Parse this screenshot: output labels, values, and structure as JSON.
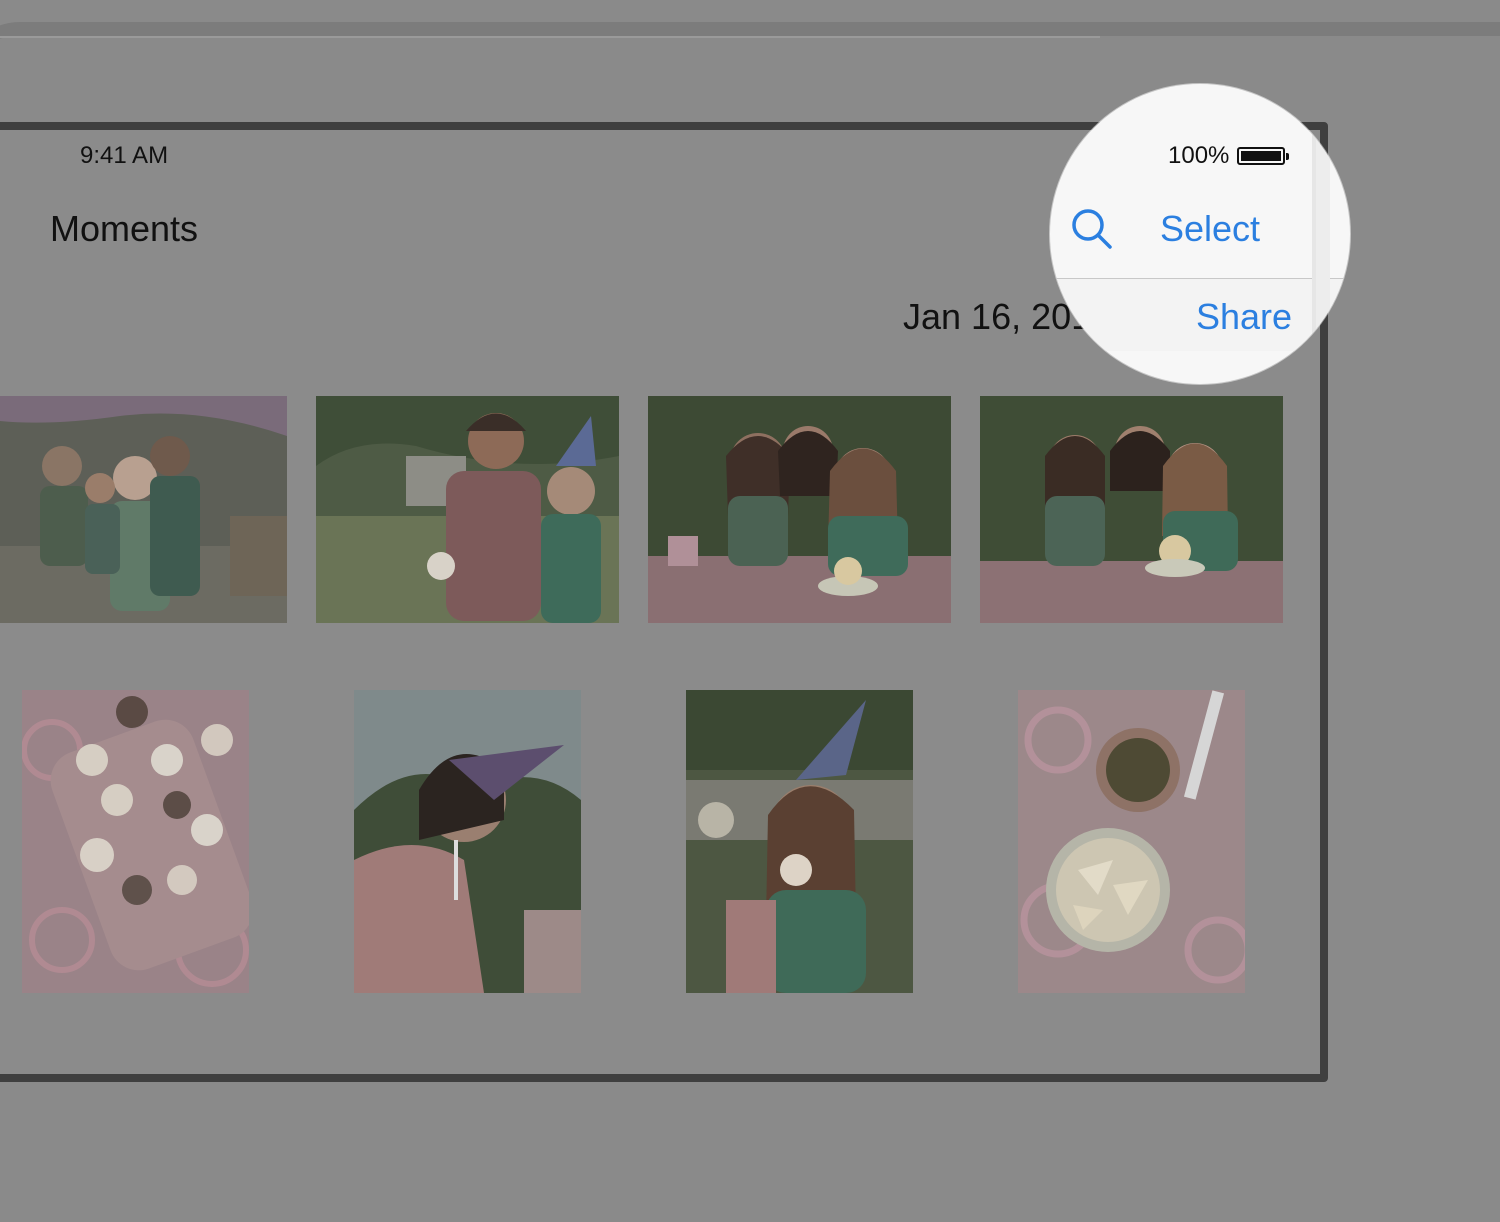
{
  "status_bar": {
    "time": "9:41 AM",
    "battery": "100%",
    "battery_level": 1.0
  },
  "nav": {
    "title": "Moments",
    "select_label": "Select"
  },
  "moment": {
    "date": "Jan 16, 2014",
    "share_label": "Share"
  },
  "icons": {
    "search": "search-icon",
    "battery": "battery-icon"
  },
  "colors": {
    "accent": "#2b7fe0",
    "dim_background": "#8a8a8a",
    "magnifier_bg": "#f7f7f7"
  },
  "photos": [
    "party-kids-umbrella",
    "boy-and-girl-party-hats",
    "family-cupcake-table",
    "family-smiling-table",
    "cupcakes-tray",
    "girl-party-hat-drinking",
    "girl-eating-cupcake",
    "dip-and-chips"
  ]
}
